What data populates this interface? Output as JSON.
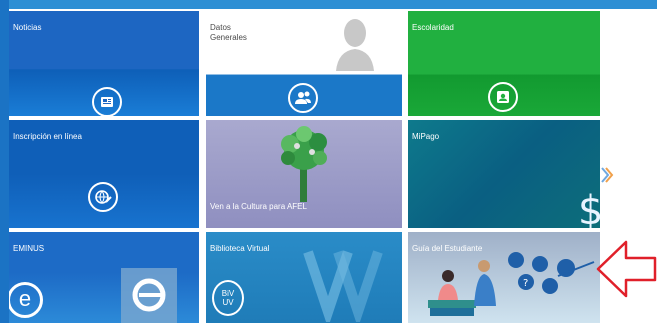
{
  "tiles": {
    "noticias": {
      "title": "Noticias"
    },
    "datos": {
      "title": "Datos\nGenerales"
    },
    "escolaridad": {
      "title": "Escolaridad"
    },
    "inscripcion": {
      "title": "Inscripción en línea"
    },
    "cultura": {
      "title": "Ven a la Cultura para AFEL"
    },
    "mipago": {
      "title": "MiPago"
    },
    "eminus": {
      "title": "EMINUS"
    },
    "biblioteca": {
      "title": "Biblioteca Virtual",
      "logo": "BiV\nUV"
    },
    "guia": {
      "title": "Guía del Estudiante"
    }
  },
  "colors": {
    "blue": "#1a6cc4",
    "green": "#19a83c",
    "teal": "#1f8db8",
    "accent_arrow": "#e0202a"
  },
  "icons": {
    "noticias": "newspaper-icon",
    "datos": "users-icon",
    "escolaridad": "contact-card-icon",
    "inscripcion": "globe-pencil-icon",
    "next": "chevron-right-icon"
  }
}
